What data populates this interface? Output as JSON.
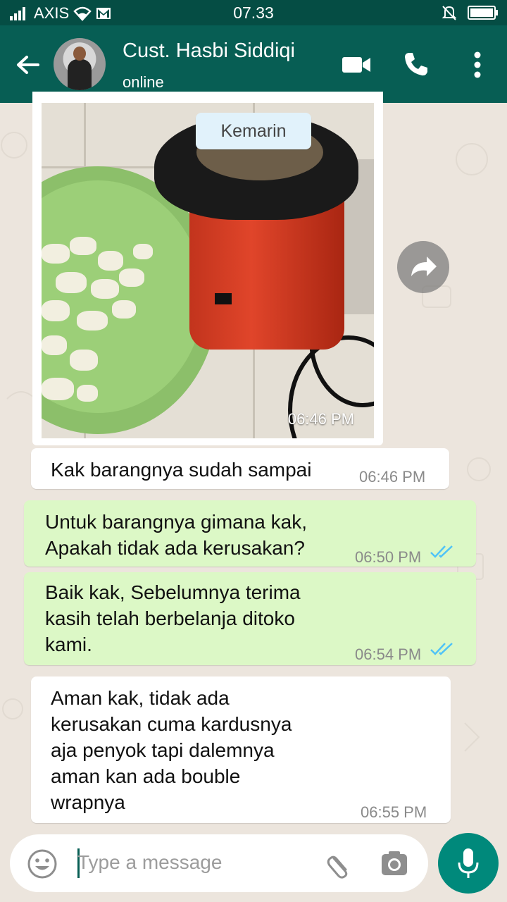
{
  "status_bar": {
    "carrier": "AXIS",
    "time": "07.33"
  },
  "header": {
    "contact_name": "Cust. Hasbi Siddiqi",
    "status": "online"
  },
  "date_chip": "Kemarin",
  "messages": [
    {
      "direction": "incoming",
      "type": "image",
      "time": "06:46 PM"
    },
    {
      "direction": "incoming",
      "text": "Kak barangnya sudah sampai",
      "time": "06:46 PM"
    },
    {
      "direction": "outgoing",
      "lines": [
        "Untuk barangnya gimana kak,",
        "Apakah tidak ada kerusakan?"
      ],
      "time": "06:50 PM",
      "status": "read"
    },
    {
      "direction": "outgoing",
      "lines": [
        "Baik kak, Sebelumnya terima",
        "kasih telah berbelanja ditoko",
        "kami."
      ],
      "time": "06:54 PM",
      "status": "read"
    },
    {
      "direction": "incoming",
      "lines": [
        "Aman kak, tidak ada",
        "kerusakan cuma kardusnya",
        "aja penyok tapi dalemnya",
        "aman kan ada bouble",
        "wrapnya"
      ],
      "time": "06:55 PM"
    }
  ],
  "composer": {
    "placeholder": "Type a message"
  },
  "colors": {
    "header": "#075e54",
    "status_bar": "#054d44",
    "outgoing_bubble": "#dcf8c6",
    "read_ticks": "#4fc3f7",
    "mic_button": "#00897b"
  },
  "icons": [
    "back-arrow-icon",
    "video-call-icon",
    "phone-icon",
    "more-vert-icon",
    "forward-icon",
    "emoji-icon",
    "attach-icon",
    "camera-icon",
    "mic-icon",
    "double-check-icon"
  ]
}
